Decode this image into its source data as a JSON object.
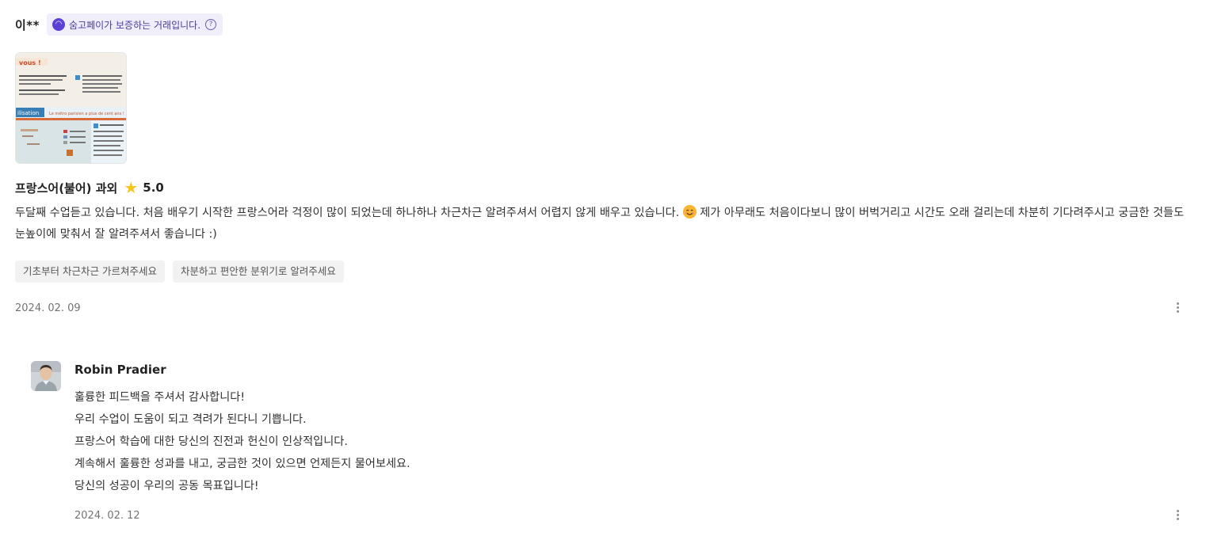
{
  "review": {
    "reviewer_name": "이**",
    "pay_badge": {
      "text": "숨고페이가 보증하는 거래입니다.",
      "logo_icon": "soomgo-pay-logo",
      "help_icon": "question-circle-icon",
      "color": "#5b40d6"
    },
    "photo_icon": "review-photo",
    "service_name": "프랑스어(불어) 과외",
    "rating": "5.0",
    "star_color": "#f5c518",
    "text_part1": "두달째 수업듣고 있습니다. 처음 배우기 시작한 프랑스어라 걱정이 많이 되었는데 하나하나 차근차근 알려주셔서 어렵지 않게 배우고 있습니다.",
    "text_part2": " 제가 아무래도 처음이다보니 많이 버벅거리고 시간도 오래 걸리는데 차분히 기다려주시고 궁금한 것들도 눈높이에 맞춰서 잘 알려주셔서 좋습니다 :)",
    "tags": [
      "기초부터 차근차근 가르쳐주세요",
      "차분하고 편안한 분위기로 알려주세요"
    ],
    "date": "2024. 02. 09"
  },
  "reply": {
    "author": "Robin Pradier",
    "lines": [
      "훌륭한 피드백을 주셔서 감사합니다!",
      "우리 수업이 도움이 되고 격려가 된다니 기쁩니다.",
      "프랑스어 학습에 대한 당신의 진전과 헌신이 인상적입니다.",
      "계속해서 훌륭한 성과를 내고, 궁금한 것이 있으면 언제든지 물어보세요.",
      "당신의 성공이 우리의 공동 목표입니다!"
    ],
    "date": "2024. 02. 12"
  }
}
